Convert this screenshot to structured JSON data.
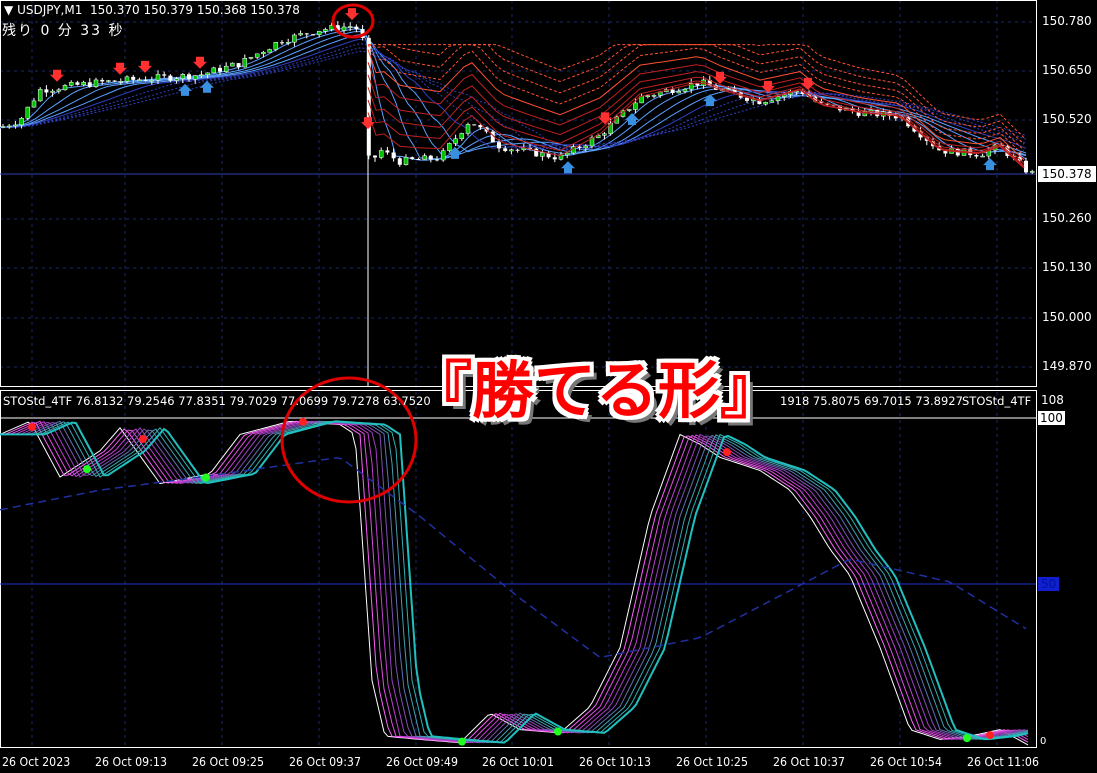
{
  "header": {
    "symbol": "USDJPY,M1",
    "ohlc": "150.370 150.379 150.368 150.378",
    "timer": "残り 0 分 33 秒"
  },
  "price_axis": {
    "labels": [
      "150.780",
      "150.650",
      "150.520",
      "150.260",
      "150.130",
      "150.000",
      "149.870"
    ],
    "current": "150.378"
  },
  "indicator": {
    "name": "STOStd_4TF",
    "values_text": "STOStd_4TF 76.8132 79.2546 77.8351 79.7029 77.0699 79.7278 63.7520",
    "values_text_right": "1918 75.8075 69.7015 73.8927",
    "name_right": "STOStd_4TF",
    "max": "108",
    "level_100": "100",
    "level_50": "50",
    "level_0": "0"
  },
  "time_axis": [
    "26 Oct 2023",
    "26 Oct 09:13",
    "26 Oct 09:25",
    "26 Oct 09:37",
    "26 Oct 09:49",
    "26 Oct 10:01",
    "26 Oct 10:13",
    "26 Oct 10:25",
    "26 Oct 10:37",
    "26 Oct 10:54",
    "26 Oct 11:06"
  ],
  "overlay_title": "『勝てる形』",
  "colors": {
    "bull": "#00c000",
    "bear": "#ffffff",
    "ribbon_up": "#3080ff",
    "ribbon_down": "#ff3030",
    "buy_arrow": "#3a90e0",
    "stoch_fast": "#ffffff",
    "stoch_mid": "#ff40ff",
    "stoch_slow": "#20b0b0",
    "annotation": "#e00000"
  },
  "chart_data": {
    "type": "line",
    "price_path": [
      [
        0,
        150.5
      ],
      [
        20,
        150.52
      ],
      [
        40,
        150.6
      ],
      [
        100,
        150.62
      ],
      [
        150,
        150.63
      ],
      [
        200,
        150.64
      ],
      [
        240,
        150.67
      ],
      [
        280,
        150.73
      ],
      [
        320,
        150.76
      ],
      [
        355,
        150.77
      ],
      [
        365,
        150.72
      ],
      [
        369,
        150.4
      ],
      [
        380,
        150.44
      ],
      [
        400,
        150.41
      ],
      [
        440,
        150.42
      ],
      [
        470,
        150.52
      ],
      [
        500,
        150.45
      ],
      [
        560,
        150.42
      ],
      [
        600,
        150.48
      ],
      [
        640,
        150.58
      ],
      [
        700,
        150.62
      ],
      [
        720,
        150.6
      ],
      [
        760,
        150.57
      ],
      [
        800,
        150.6
      ],
      [
        820,
        150.56
      ],
      [
        860,
        150.54
      ],
      [
        900,
        150.53
      ],
      [
        940,
        150.44
      ],
      [
        980,
        150.43
      ],
      [
        1000,
        150.45
      ],
      [
        1030,
        150.378
      ]
    ],
    "stoch_fast": [
      [
        0,
        95
      ],
      [
        30,
        99
      ],
      [
        60,
        82
      ],
      [
        100,
        90
      ],
      [
        120,
        97
      ],
      [
        160,
        80
      ],
      [
        210,
        83
      ],
      [
        240,
        95
      ],
      [
        290,
        99
      ],
      [
        340,
        98
      ],
      [
        355,
        95
      ],
      [
        372,
        20
      ],
      [
        385,
        3
      ],
      [
        420,
        2
      ],
      [
        460,
        1
      ],
      [
        490,
        10
      ],
      [
        520,
        5
      ],
      [
        560,
        4
      ],
      [
        590,
        12
      ],
      [
        620,
        30
      ],
      [
        650,
        70
      ],
      [
        680,
        95
      ],
      [
        700,
        92
      ],
      [
        720,
        88
      ],
      [
        760,
        84
      ],
      [
        790,
        78
      ],
      [
        810,
        70
      ],
      [
        830,
        60
      ],
      [
        850,
        52
      ],
      [
        880,
        30
      ],
      [
        910,
        5
      ],
      [
        940,
        2
      ],
      [
        970,
        3
      ],
      [
        1000,
        5
      ],
      [
        1030,
        0
      ]
    ],
    "stoch_slow_dashed": [
      [
        0,
        72
      ],
      [
        100,
        78
      ],
      [
        200,
        82
      ],
      [
        340,
        88
      ],
      [
        420,
        70
      ],
      [
        520,
        45
      ],
      [
        600,
        27
      ],
      [
        700,
        33
      ],
      [
        850,
        57
      ],
      [
        950,
        50
      ],
      [
        1030,
        35
      ]
    ],
    "ylim": [
      0,
      100
    ]
  }
}
